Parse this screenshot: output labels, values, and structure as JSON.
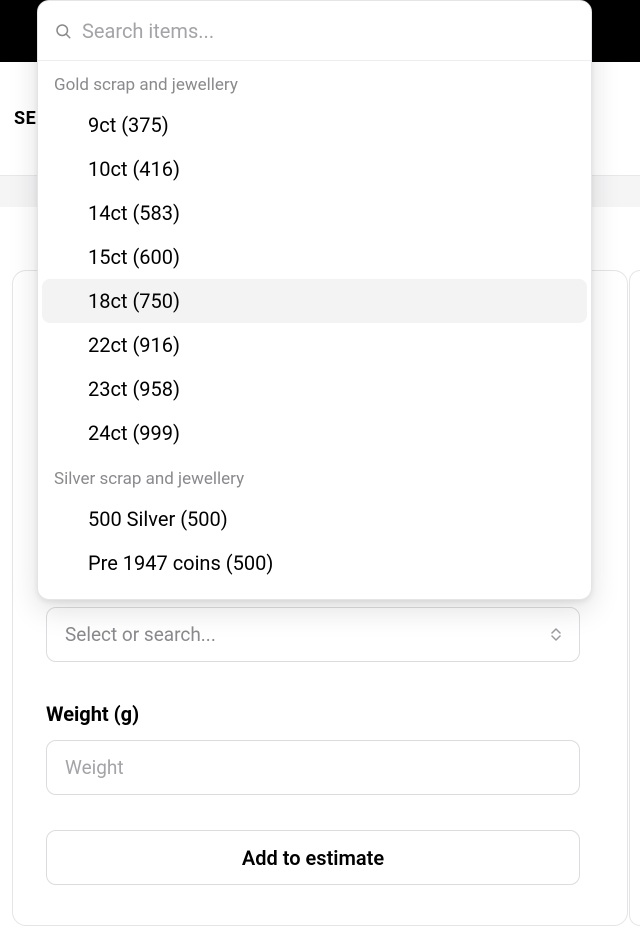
{
  "header": {
    "partial_text": "SE"
  },
  "dropdown": {
    "search_placeholder": "Search items...",
    "groups": [
      {
        "label": "Gold scrap and jewellery",
        "items": [
          {
            "label": "9ct (375)",
            "highlighted": false
          },
          {
            "label": "10ct (416)",
            "highlighted": false
          },
          {
            "label": "14ct (583)",
            "highlighted": false
          },
          {
            "label": "15ct (600)",
            "highlighted": false
          },
          {
            "label": "18ct (750)",
            "highlighted": true
          },
          {
            "label": "22ct (916)",
            "highlighted": false
          },
          {
            "label": "23ct (958)",
            "highlighted": false
          },
          {
            "label": "24ct (999)",
            "highlighted": false
          }
        ]
      },
      {
        "label": "Silver scrap and jewellery",
        "items": [
          {
            "label": "500 Silver (500)",
            "highlighted": false
          },
          {
            "label": "Pre 1947 coins (500)",
            "highlighted": false
          }
        ]
      }
    ]
  },
  "form": {
    "select_placeholder": "Select or search...",
    "weight_label": "Weight (g)",
    "weight_placeholder": "Weight",
    "add_button_label": "Add to estimate"
  }
}
